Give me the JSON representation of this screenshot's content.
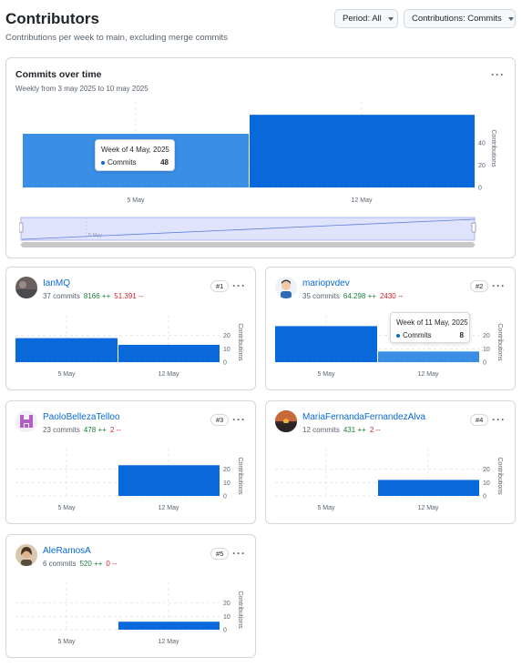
{
  "header": {
    "title": "Contributors",
    "subtitle": "Contributions per week to main, excluding merge commits",
    "period_button": "Period: All",
    "contributions_button": "Contributions: Commits"
  },
  "overview": {
    "title": "Commits over time",
    "subtitle": "Weekly from 3 may 2025 to 10 may 2025",
    "y_axis_label": "Contributions",
    "range_label": "5 May",
    "tooltip": {
      "week": "Week of 4 May, 2025",
      "series": "Commits",
      "value": "48"
    }
  },
  "chart_data": [
    {
      "type": "bar",
      "categories": [
        "5 May",
        "12 May"
      ],
      "values": [
        48,
        65
      ],
      "ylabel": "Contributions",
      "yticks": [
        0,
        20,
        40
      ],
      "ylim": [
        0,
        70
      ]
    },
    {
      "type": "bar",
      "categories": [
        "5 May",
        "12 May"
      ],
      "values": [
        18,
        13
      ],
      "ylabel": "Contributions",
      "yticks": [
        0,
        10,
        20
      ],
      "ylim": [
        0,
        30
      ]
    },
    {
      "type": "bar",
      "categories": [
        "5 May",
        "12 May"
      ],
      "values": [
        27,
        8
      ],
      "ylabel": "Contributions",
      "yticks": [
        0,
        10,
        20
      ],
      "ylim": [
        0,
        30
      ]
    },
    {
      "type": "bar",
      "categories": [
        "5 May",
        "12 May"
      ],
      "values": [
        0,
        23
      ],
      "ylabel": "Contributions",
      "yticks": [
        0,
        10,
        20
      ],
      "ylim": [
        0,
        30
      ]
    },
    {
      "type": "bar",
      "categories": [
        "5 May",
        "12 May"
      ],
      "values": [
        0,
        12
      ],
      "ylabel": "Contributions",
      "yticks": [
        0,
        10,
        20
      ],
      "ylim": [
        0,
        30
      ]
    },
    {
      "type": "bar",
      "categories": [
        "5 May",
        "12 May"
      ],
      "values": [
        0,
        6
      ],
      "ylabel": "Contributions",
      "yticks": [
        0,
        10,
        20
      ],
      "ylim": [
        0,
        30
      ]
    }
  ],
  "contributors": [
    {
      "name": "IanMQ",
      "commits": "37 commits",
      "additions": "8166 ++",
      "deletions": "51.391 --",
      "rank": "#1",
      "avatar": "grey-landscape"
    },
    {
      "name": "mariopvdev",
      "commits": "35 commits",
      "additions": "64.298 ++",
      "deletions": "2430 --",
      "rank": "#2",
      "avatar": "person-illustration",
      "tooltip": {
        "week": "Week of 11 May, 2025",
        "series": "Commits",
        "value": "8"
      }
    },
    {
      "name": "PaoloBellezaTelloo",
      "commits": "23 commits",
      "additions": "478 ++",
      "deletions": "2 --",
      "rank": "#3",
      "avatar": "purple-identicon"
    },
    {
      "name": "MariaFernandaFernandezAlva",
      "commits": "12 commits",
      "additions": "431 ++",
      "deletions": "2 --",
      "rank": "#4",
      "avatar": "sunset-photo"
    },
    {
      "name": "AleRamosA",
      "commits": "6 commits",
      "additions": "520 ++",
      "deletions": "0 --",
      "rank": "#5",
      "avatar": "portrait-photo"
    }
  ],
  "colors": {
    "bar": "#0969da",
    "bar_hover": "#3a8ee6",
    "add": "#1a7f37",
    "del": "#d1242f",
    "link": "#0969da"
  }
}
